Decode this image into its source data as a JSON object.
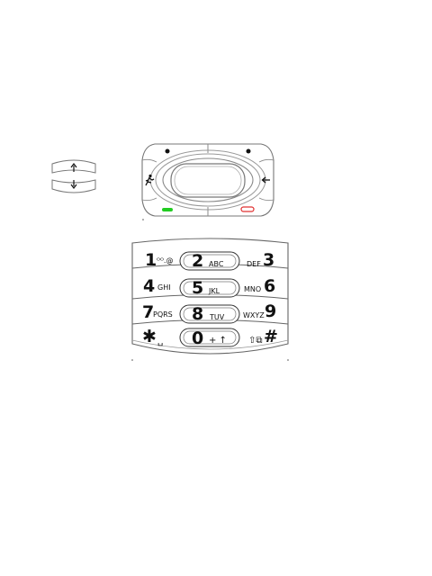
{
  "colors": {
    "outline": "#666666",
    "call_green": "#22cc22",
    "end_red": "#e03030"
  },
  "volume_rocker": {
    "up_icon": "arrow-up-icon",
    "down_icon": "arrow-down-icon"
  },
  "nav_pad": {
    "left_soft_icon": "dot-icon",
    "right_soft_icon": "dot-icon",
    "left_icon": "running-person-icon",
    "right_icon": "back-arrow-icon",
    "call_icon": "call-key-icon",
    "end_icon": "end-key-icon"
  },
  "keypad": {
    "rows": [
      {
        "left": {
          "digit": "1",
          "letters": "ᴼᴼ.@"
        },
        "center": {
          "digit": "2",
          "letters": "ABC"
        },
        "right": {
          "digit": "3",
          "letters": "DEF"
        }
      },
      {
        "left": {
          "digit": "4",
          "letters": "GHI"
        },
        "center": {
          "digit": "5",
          "letters": "JKL"
        },
        "right": {
          "digit": "6",
          "letters": "MNO"
        }
      },
      {
        "left": {
          "digit": "7",
          "letters": "PQRS"
        },
        "center": {
          "digit": "8",
          "letters": "TUV"
        },
        "right": {
          "digit": "9",
          "letters": "WXYZ"
        }
      },
      {
        "left": {
          "digit": "✱",
          "letters": "␣"
        },
        "center": {
          "digit": "0",
          "letters": "+ ↑"
        },
        "right": {
          "digit": "#",
          "letters": "⇧⧉"
        }
      }
    ]
  }
}
